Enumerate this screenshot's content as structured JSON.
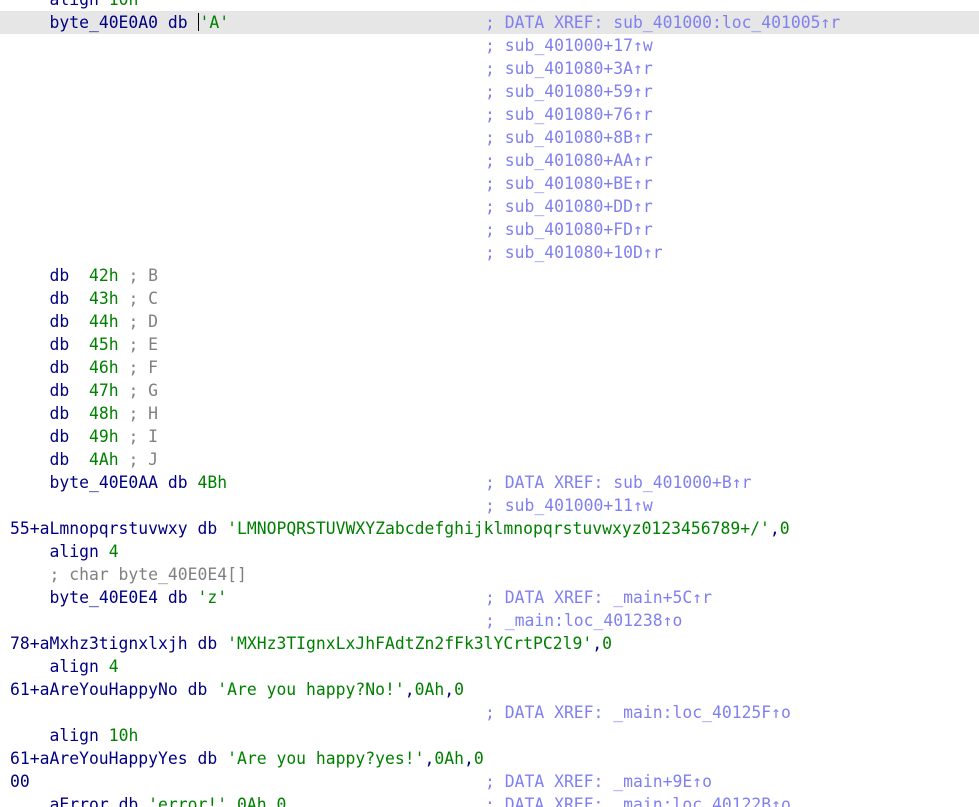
{
  "window": {
    "title": "IDA View-A"
  },
  "colors": {
    "background": "#ffffff",
    "current_line": "#e6e6e6",
    "code": "#000080",
    "value": "#008000",
    "xref_comment": "#8080f0",
    "inline_comment": "#808080"
  },
  "lines": [
    {
      "indent": "    ",
      "parts": [
        {
          "t": "align ",
          "c": "kw"
        },
        {
          "t": "10h",
          "c": "num"
        }
      ]
    },
    {
      "current": true,
      "cursor": true,
      "indent": "    ",
      "parts": [
        {
          "t": "byte_40E0A0 ",
          "c": "name"
        },
        {
          "t": "db ",
          "c": "kw"
        },
        {
          "t": "'A'",
          "c": "str"
        }
      ],
      "comment": "; DATA XREF: sub_401000:loc_401005↑r"
    },
    {
      "indent": "",
      "parts": [],
      "comment": "; sub_401000+17↑w"
    },
    {
      "indent": "",
      "parts": [],
      "comment": "; sub_401080+3A↑r"
    },
    {
      "indent": "",
      "parts": [],
      "comment": "; sub_401080+59↑r"
    },
    {
      "indent": "",
      "parts": [],
      "comment": "; sub_401080+76↑r"
    },
    {
      "indent": "",
      "parts": [],
      "comment": "; sub_401080+8B↑r"
    },
    {
      "indent": "",
      "parts": [],
      "comment": "; sub_401080+AA↑r"
    },
    {
      "indent": "",
      "parts": [],
      "comment": "; sub_401080+BE↑r"
    },
    {
      "indent": "",
      "parts": [],
      "comment": "; sub_401080+DD↑r"
    },
    {
      "indent": "",
      "parts": [],
      "comment": "; sub_401080+FD↑r"
    },
    {
      "indent": "",
      "parts": [],
      "comment": "; sub_401080+10D↑r"
    },
    {
      "indent": "    ",
      "parts": [
        {
          "t": "db  ",
          "c": "kw"
        },
        {
          "t": "42h",
          "c": "num"
        },
        {
          "t": " ; B",
          "c": "icmt"
        }
      ]
    },
    {
      "indent": "    ",
      "parts": [
        {
          "t": "db  ",
          "c": "kw"
        },
        {
          "t": "43h",
          "c": "num"
        },
        {
          "t": " ; C",
          "c": "icmt"
        }
      ]
    },
    {
      "indent": "    ",
      "parts": [
        {
          "t": "db  ",
          "c": "kw"
        },
        {
          "t": "44h",
          "c": "num"
        },
        {
          "t": " ; D",
          "c": "icmt"
        }
      ]
    },
    {
      "indent": "    ",
      "parts": [
        {
          "t": "db  ",
          "c": "kw"
        },
        {
          "t": "45h",
          "c": "num"
        },
        {
          "t": " ; E",
          "c": "icmt"
        }
      ]
    },
    {
      "indent": "    ",
      "parts": [
        {
          "t": "db  ",
          "c": "kw"
        },
        {
          "t": "46h",
          "c": "num"
        },
        {
          "t": " ; F",
          "c": "icmt"
        }
      ]
    },
    {
      "indent": "    ",
      "parts": [
        {
          "t": "db  ",
          "c": "kw"
        },
        {
          "t": "47h",
          "c": "num"
        },
        {
          "t": " ; G",
          "c": "icmt"
        }
      ]
    },
    {
      "indent": "    ",
      "parts": [
        {
          "t": "db  ",
          "c": "kw"
        },
        {
          "t": "48h",
          "c": "num"
        },
        {
          "t": " ; H",
          "c": "icmt"
        }
      ]
    },
    {
      "indent": "    ",
      "parts": [
        {
          "t": "db  ",
          "c": "kw"
        },
        {
          "t": "49h",
          "c": "num"
        },
        {
          "t": " ; I",
          "c": "icmt"
        }
      ]
    },
    {
      "indent": "    ",
      "parts": [
        {
          "t": "db  ",
          "c": "kw"
        },
        {
          "t": "4Ah",
          "c": "num"
        },
        {
          "t": " ; J",
          "c": "icmt"
        }
      ]
    },
    {
      "indent": "    ",
      "parts": [
        {
          "t": "byte_40E0AA ",
          "c": "name"
        },
        {
          "t": "db ",
          "c": "kw"
        },
        {
          "t": "4Bh",
          "c": "num"
        }
      ],
      "comment": "; DATA XREF: sub_401000+B↑r"
    },
    {
      "indent": "",
      "parts": [],
      "comment": "; sub_401000+11↑w"
    },
    {
      "indent": "",
      "parts": [
        {
          "t": "55+aLmnopqrstuvwxy ",
          "c": "name"
        },
        {
          "t": "db ",
          "c": "kw"
        },
        {
          "t": "'LMNOPQRSTUVWXYZabcdefghijklmnopqrstuvwxyz0123456789+/'",
          "c": "str"
        },
        {
          "t": ",",
          "c": "punc"
        },
        {
          "t": "0",
          "c": "num"
        }
      ]
    },
    {
      "indent": "    ",
      "parts": [
        {
          "t": "align ",
          "c": "kw"
        },
        {
          "t": "4",
          "c": "num"
        }
      ]
    },
    {
      "indent": "    ",
      "parts": [
        {
          "t": "; char byte_40E0E4[]",
          "c": "icmt"
        }
      ]
    },
    {
      "indent": "    ",
      "parts": [
        {
          "t": "byte_40E0E4 ",
          "c": "name"
        },
        {
          "t": "db ",
          "c": "kw"
        },
        {
          "t": "'z'",
          "c": "str"
        }
      ],
      "comment": "; DATA XREF: _main+5C↑r"
    },
    {
      "indent": "",
      "parts": [],
      "comment": "; _main:loc_401238↑o"
    },
    {
      "indent": "",
      "parts": [
        {
          "t": "78+aMxhz3tignxlxjh ",
          "c": "name"
        },
        {
          "t": "db ",
          "c": "kw"
        },
        {
          "t": "'MXHz3TIgnxLxJhFAdtZn2fFk3lYCrtPC2l9'",
          "c": "str"
        },
        {
          "t": ",",
          "c": "punc"
        },
        {
          "t": "0",
          "c": "num"
        }
      ]
    },
    {
      "indent": "    ",
      "parts": [
        {
          "t": "align ",
          "c": "kw"
        },
        {
          "t": "4",
          "c": "num"
        }
      ]
    },
    {
      "indent": "",
      "parts": [
        {
          "t": "61+aAreYouHappyNo ",
          "c": "name"
        },
        {
          "t": "db ",
          "c": "kw"
        },
        {
          "t": "'Are you happy?No!'",
          "c": "str"
        },
        {
          "t": ",",
          "c": "punc"
        },
        {
          "t": "0Ah",
          "c": "num"
        },
        {
          "t": ",",
          "c": "punc"
        },
        {
          "t": "0",
          "c": "num"
        }
      ]
    },
    {
      "indent": "",
      "parts": [],
      "comment": "; DATA XREF: _main:loc_40125F↑o"
    },
    {
      "indent": "    ",
      "parts": [
        {
          "t": "align ",
          "c": "kw"
        },
        {
          "t": "10h",
          "c": "num"
        }
      ]
    },
    {
      "indent": "",
      "parts": [
        {
          "t": "61+aAreYouHappyYes ",
          "c": "name"
        },
        {
          "t": "db ",
          "c": "kw"
        },
        {
          "t": "'Are you happy?yes!'",
          "c": "str"
        },
        {
          "t": ",",
          "c": "punc"
        },
        {
          "t": "0Ah",
          "c": "num"
        },
        {
          "t": ",",
          "c": "punc"
        },
        {
          "t": "0",
          "c": "num"
        }
      ]
    },
    {
      "indent": "",
      "parts": [
        {
          "t": "00",
          "c": "name"
        }
      ],
      "comment": "; DATA XREF: _main+9E↑o"
    },
    {
      "indent": "    ",
      "parts": [
        {
          "t": "aError ",
          "c": "name"
        },
        {
          "t": "db ",
          "c": "kw"
        },
        {
          "t": "'error!'",
          "c": "str"
        },
        {
          "t": ",",
          "c": "punc"
        },
        {
          "t": "0Ah",
          "c": "num"
        },
        {
          "t": ",",
          "c": "punc"
        },
        {
          "t": "0",
          "c": "num"
        }
      ],
      "comment": "; DATA XREF: _main:loc_40122B↑o"
    }
  ]
}
